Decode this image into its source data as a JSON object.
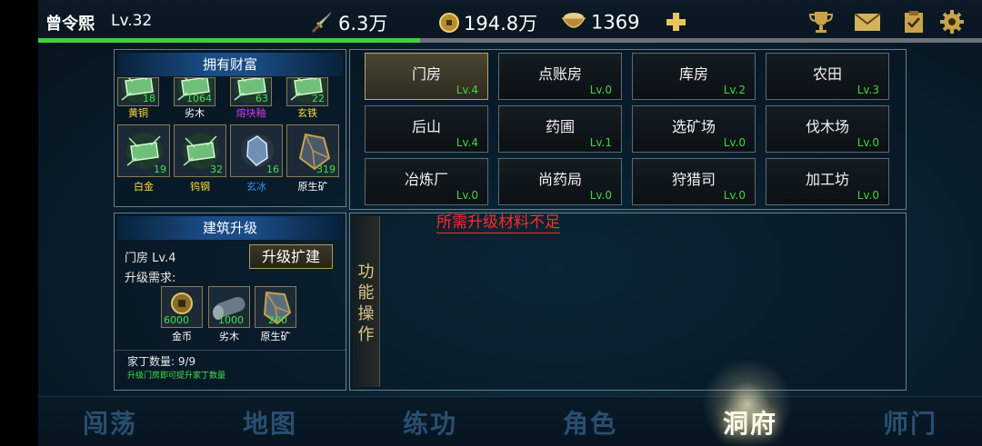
{
  "player": {
    "name": "曾令熙",
    "level": "Lv.32",
    "exp_fraction": 0.405
  },
  "resources": {
    "power": "6.3万",
    "coins": "194.8万",
    "food": "1369"
  },
  "top_icons": [
    "plus-icon",
    "trophy-icon",
    "mail-icon",
    "clipboard-icon",
    "gear-icon"
  ],
  "wealth": {
    "title": "拥有财富",
    "row1": [
      {
        "name": "黄铜",
        "count": "18",
        "color": "#ffdc3c"
      },
      {
        "name": "劣木",
        "count": "1064",
        "color": "#ffffff"
      },
      {
        "name": "熔块釉",
        "count": "63",
        "color": "#d23cf0"
      },
      {
        "name": "玄铁",
        "count": "22",
        "color": "#ffdc3c"
      }
    ],
    "row2": [
      {
        "name": "白金",
        "count": "19",
        "color": "#ffdc3c"
      },
      {
        "name": "钨钢",
        "count": "32",
        "color": "#ffdc3c"
      },
      {
        "name": "玄冰",
        "count": "16",
        "color": "#3a8cff"
      },
      {
        "name": "原生矿",
        "count": "319",
        "color": "#ffffff"
      }
    ]
  },
  "upgrade": {
    "title": "建筑升级",
    "building": "门房 Lv.4",
    "button": "升级扩建",
    "req_label": "升级需求:",
    "materials": [
      {
        "name": "金币",
        "count": "6000"
      },
      {
        "name": "劣木",
        "count": "1000"
      },
      {
        "name": "原生矿",
        "count": "200"
      }
    ],
    "servants": "家丁数量: 9/9",
    "hint": "升级门房即可提升家丁数量"
  },
  "buildings": [
    {
      "name": "门房",
      "level": "Lv.4"
    },
    {
      "name": "点账房",
      "level": "Lv.0"
    },
    {
      "name": "库房",
      "level": "Lv.2"
    },
    {
      "name": "农田",
      "level": "Lv.3"
    },
    {
      "name": "后山",
      "level": "Lv.4"
    },
    {
      "name": "药圃",
      "level": "Lv.1"
    },
    {
      "name": "选矿场",
      "level": "Lv.0"
    },
    {
      "name": "伐木场",
      "level": "Lv.0"
    },
    {
      "name": "冶炼厂",
      "level": "Lv.0"
    },
    {
      "name": "尚药局",
      "level": "Lv.0"
    },
    {
      "name": "狩猎司",
      "level": "Lv.0"
    },
    {
      "name": "加工坊",
      "level": "Lv.0"
    }
  ],
  "function_panel": {
    "label_chars": [
      "功",
      "能",
      "操",
      "作"
    ],
    "warning": "所需升级材料不足"
  },
  "nav": [
    "闯荡",
    "地图",
    "练功",
    "角色",
    "洞府",
    "师门"
  ],
  "active_nav": "洞府"
}
